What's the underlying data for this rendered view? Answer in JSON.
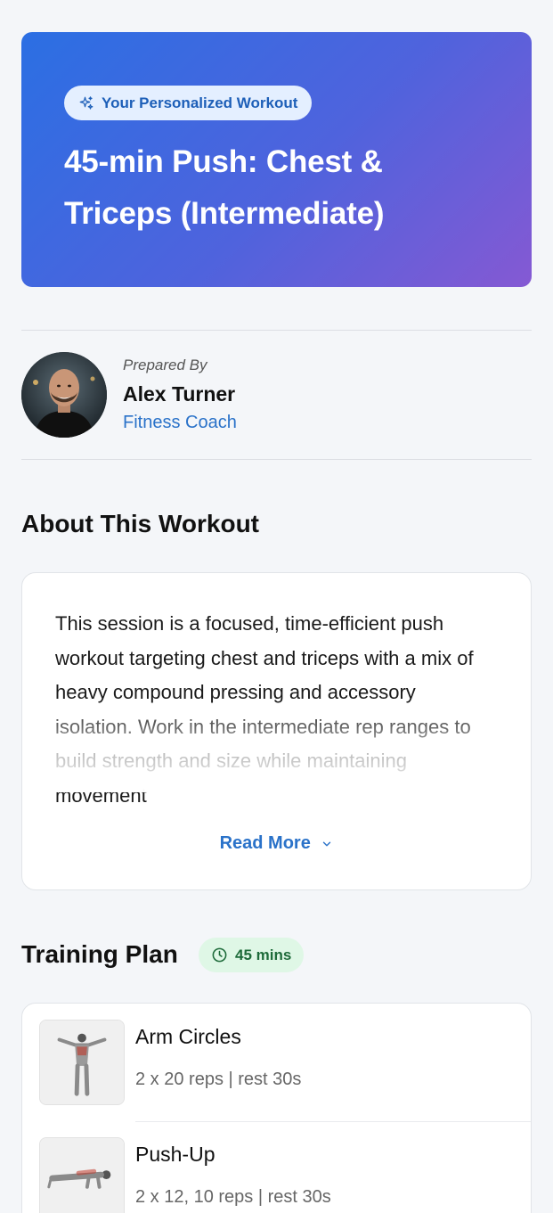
{
  "hero": {
    "badge": "Your Personalized Workout",
    "title": "45-min Push: Chest & Triceps (Intermediate)"
  },
  "author": {
    "prepared_label": "Prepared By",
    "name": "Alex Turner",
    "role": "Fitness Coach"
  },
  "about": {
    "heading": "About This Workout",
    "text": "This session is a focused, time-efficient push workout targeting chest and triceps with a mix of heavy compound pressing and accessory isolation. Work in the intermediate rep ranges to build strength and size while maintaining movement",
    "read_more": "Read More"
  },
  "plan": {
    "heading": "Training Plan",
    "duration": "45 mins",
    "exercises": [
      {
        "name": "Arm Circles",
        "meta": "2 x 20 reps | rest 30s"
      },
      {
        "name": "Push-Up",
        "meta": "2 x 12, 10 reps | rest 30s"
      }
    ]
  },
  "colors": {
    "hero_gradient_start": "#2b6fe3",
    "hero_gradient_end": "#8559d3",
    "accent_blue": "#2a72c9",
    "duration_badge_bg": "#dff7e6",
    "duration_badge_text": "#1e6b3a"
  },
  "icons": {
    "hero_badge": "sparkle-icon",
    "duration": "clock-icon",
    "read_more": "chevron-down-icon"
  }
}
